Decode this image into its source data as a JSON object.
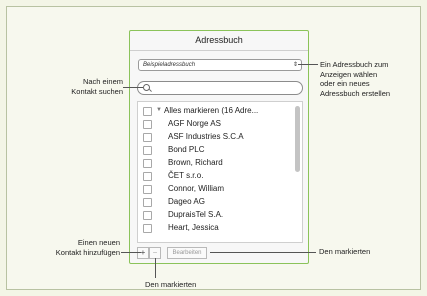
{
  "panel": {
    "title": "Adressbuch",
    "addressbook_select": "Beispieladressbuch",
    "select_arrows": "⇕",
    "search_placeholder": "",
    "select_all_label": "Alles markieren (16 Adre...",
    "contacts": [
      "AGF Norge AS",
      "ASF Industries S.C.A",
      "Bond PLC",
      "Brown, Richard",
      "ČET s.r.o.",
      "Connor, William",
      "Dageo AG",
      "DupraisTel S.A.",
      "Heart, Jessica"
    ],
    "add_button": "+",
    "remove_button": "−",
    "edit_button": "Bearbeiten"
  },
  "annotations": {
    "search_line1": "Nach einem",
    "search_line2": "Kontakt suchen",
    "select_line1": "Ein Adressbuch zum",
    "select_line2": "Anzeigen wählen",
    "select_line3": "oder ein neues",
    "select_line4": "Adressbuch erstellen",
    "add_line1": "Einen neuen",
    "add_line2": "Kontakt hinzufügen",
    "edit_note": "Den markierten",
    "remove_note": "Den markierten"
  },
  "colors": {
    "panel_border": "#8bc35a",
    "background": "#f3f5e6"
  }
}
